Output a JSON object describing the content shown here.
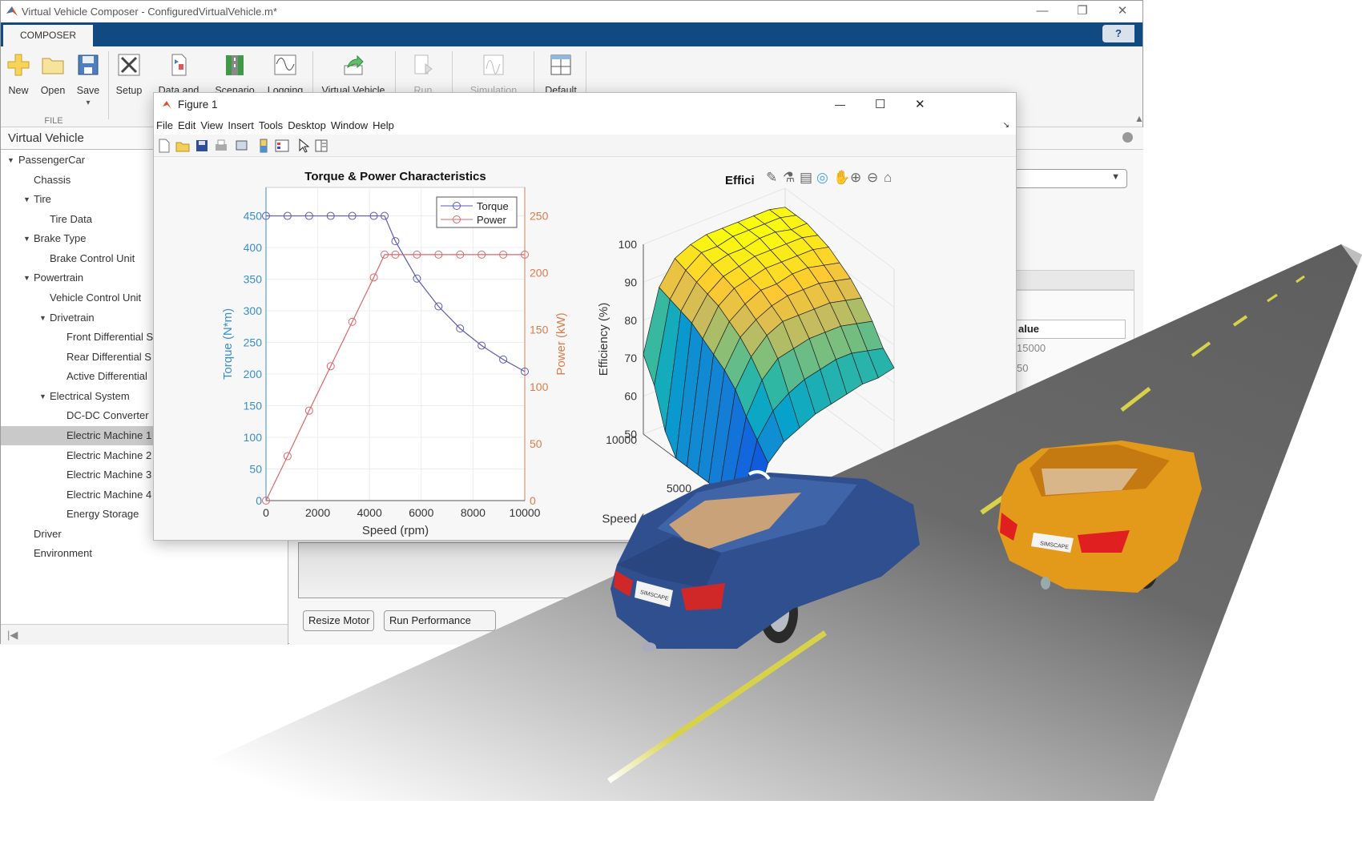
{
  "app": {
    "title": "Virtual Vehicle Composer - ConfiguredVirtualVehicle.m*",
    "window_controls": {
      "minimize": "—",
      "restore": "❐",
      "close": "✕"
    },
    "tab": "COMPOSER",
    "help": "?",
    "accent": "#104a80"
  },
  "toolstrip": {
    "buttons": [
      {
        "label": "New",
        "icon": "plus-icon"
      },
      {
        "label": "Open",
        "icon": "folder-icon"
      },
      {
        "label": "Save",
        "icon": "save-icon",
        "dropdown": "▾"
      },
      {
        "label": "Setup",
        "icon": "tools-icon"
      },
      {
        "label": "Data and",
        "icon": "data-icon"
      },
      {
        "label": "Scenario",
        "icon": "scenario-icon"
      },
      {
        "label": "Logging",
        "icon": "logging-icon"
      },
      {
        "label": "Virtual Vehicle",
        "icon": "build-icon"
      },
      {
        "label": "Run",
        "icon": "run-icon",
        "disabled": true
      },
      {
        "label": "Simulation",
        "icon": "simulation-icon",
        "disabled": true
      },
      {
        "label": "Default",
        "icon": "layout-icon"
      }
    ],
    "section_file": "FILE"
  },
  "sidebar": {
    "title": "Virtual Vehicle",
    "tree": [
      {
        "label": "PassengerCar",
        "level": 0,
        "expanded": true
      },
      {
        "label": "Chassis",
        "level": 1
      },
      {
        "label": "Tire",
        "level": 1,
        "expanded": true
      },
      {
        "label": "Tire Data",
        "level": 2
      },
      {
        "label": "Brake Type",
        "level": 1,
        "expanded": true
      },
      {
        "label": "Brake Control Unit",
        "level": 2
      },
      {
        "label": "Powertrain",
        "level": 1,
        "expanded": true
      },
      {
        "label": "Vehicle Control Unit",
        "level": 2
      },
      {
        "label": "Drivetrain",
        "level": 2,
        "expanded": true
      },
      {
        "label": "Front Differential S",
        "level": 3
      },
      {
        "label": "Rear Differential S",
        "level": 3
      },
      {
        "label": "Active Differential",
        "level": 3
      },
      {
        "label": "Electrical System",
        "level": 2,
        "expanded": true
      },
      {
        "label": "DC-DC Converter",
        "level": 3
      },
      {
        "label": "Electric Machine 1",
        "level": 3,
        "selected": true
      },
      {
        "label": "Electric Machine 2",
        "level": 3
      },
      {
        "label": "Electric Machine 3",
        "level": 3
      },
      {
        "label": "Electric Machine 4",
        "level": 3
      },
      {
        "label": "Energy Storage",
        "level": 3
      },
      {
        "label": "Driver",
        "level": 1
      },
      {
        "label": "Environment",
        "level": 1
      }
    ],
    "scroll_icon": "|◀"
  },
  "main": {
    "buttons": {
      "resize": "Resize Motor",
      "run_perf": "Run Performance"
    },
    "table_header": "alue",
    "table_values": [
      "15000",
      "50"
    ]
  },
  "figure": {
    "title": "Figure 1",
    "controls": {
      "minimize": "—",
      "maximize": "☐",
      "close": "✕"
    },
    "menu": [
      "File",
      "Edit",
      "View",
      "Insert",
      "Tools",
      "Desktop",
      "Window",
      "Help"
    ],
    "toolbar": [
      "new-figure-icon",
      "open-icon",
      "save-icon",
      "print-icon",
      "print-preview-icon",
      "colorbar-icon",
      "legend-icon",
      "pointer-icon",
      "property-inspector-icon"
    ],
    "axes_toolbar": [
      "brush-icon",
      "datatip-icon",
      "restore-view-icon",
      "rotate-icon",
      "pan-icon",
      "zoom-in-icon",
      "zoom-out-icon",
      "home-icon"
    ]
  },
  "chart_data": [
    {
      "type": "line",
      "title": "Torque & Power Characteristics",
      "xlabel": "Speed (rpm)",
      "ylabel_left": "Torque (N*m)",
      "ylabel_right": "Power (kW)",
      "xlim": [
        0,
        10000
      ],
      "ylim_left": [
        0,
        495
      ],
      "ylim_right": [
        0,
        275
      ],
      "xticks": [
        0,
        2000,
        4000,
        6000,
        8000,
        10000
      ],
      "yticks_left": [
        0,
        50,
        100,
        150,
        200,
        250,
        300,
        350,
        400,
        450
      ],
      "yticks_right": [
        0,
        50,
        100,
        150,
        200,
        250
      ],
      "grid": true,
      "legend": "top-right",
      "x": [
        0,
        833,
        1667,
        2500,
        3333,
        4167,
        4583,
        5000,
        5833,
        6667,
        7500,
        8333,
        9167,
        10000
      ],
      "series": [
        {
          "name": "Torque",
          "axis": "left",
          "color": "#5a5ab4",
          "marker": "circle",
          "values": [
            450,
            450,
            450,
            450,
            450,
            450,
            450,
            410,
            351,
            307,
            272,
            245,
            223,
            204
          ]
        },
        {
          "name": "Power",
          "axis": "right",
          "color": "#d9676b",
          "marker": "circle",
          "values": [
            0,
            39,
            79,
            118,
            157,
            196,
            216,
            216,
            216,
            216,
            216,
            216,
            216,
            216
          ]
        }
      ],
      "left_axis_color": "#3a8ec4",
      "right_axis_color": "#d97c4c"
    },
    {
      "type": "surface",
      "title": "Effici",
      "xlabel": "Speed (rpm)",
      "zlabel": "Efficiency (%)",
      "zlim": [
        50,
        100
      ],
      "zticks": [
        50,
        60,
        70,
        80,
        90,
        100
      ],
      "xticks_labeled": [
        5000,
        10000
      ],
      "xlim": [
        0,
        10000
      ],
      "colormap": "parula",
      "speed": [
        0,
        1000,
        2000,
        3000,
        4000,
        5000,
        6000,
        7000,
        8000,
        9000,
        10000
      ],
      "z": [
        [
          50,
          50,
          50,
          50,
          50,
          50,
          50,
          50,
          55,
          65,
          71
        ],
        [
          62,
          66,
          70,
          75,
          78,
          80,
          82,
          84,
          85,
          86,
          87
        ],
        [
          66,
          72,
          78,
          82,
          85,
          87,
          89,
          90,
          91,
          92,
          93
        ],
        [
          68,
          75,
          82,
          86,
          88,
          90,
          92,
          93,
          94,
          95,
          95
        ],
        [
          70,
          77,
          83,
          88,
          90,
          92,
          93,
          94,
          95,
          95,
          96
        ],
        [
          71,
          78,
          84,
          88,
          91,
          92,
          94,
          95,
          95,
          96,
          96
        ],
        [
          72,
          79,
          84,
          88,
          91,
          93,
          94,
          95,
          96,
          96,
          96
        ],
        [
          73,
          79,
          84,
          88,
          91,
          93,
          94,
          95,
          96,
          96,
          96
        ],
        [
          73,
          78,
          83,
          87,
          90,
          92,
          94,
          95,
          95,
          96,
          96
        ],
        [
          74,
          77,
          82,
          86,
          89,
          91,
          93,
          94,
          95,
          95,
          95
        ]
      ]
    }
  ],
  "scene": {
    "road_color": "#5e5e5e",
    "lane_color": "#d8d24a",
    "car1_color": "#2f4f8f",
    "car2_color": "#e39a1a",
    "plate_text": "SIMSCAPE"
  }
}
